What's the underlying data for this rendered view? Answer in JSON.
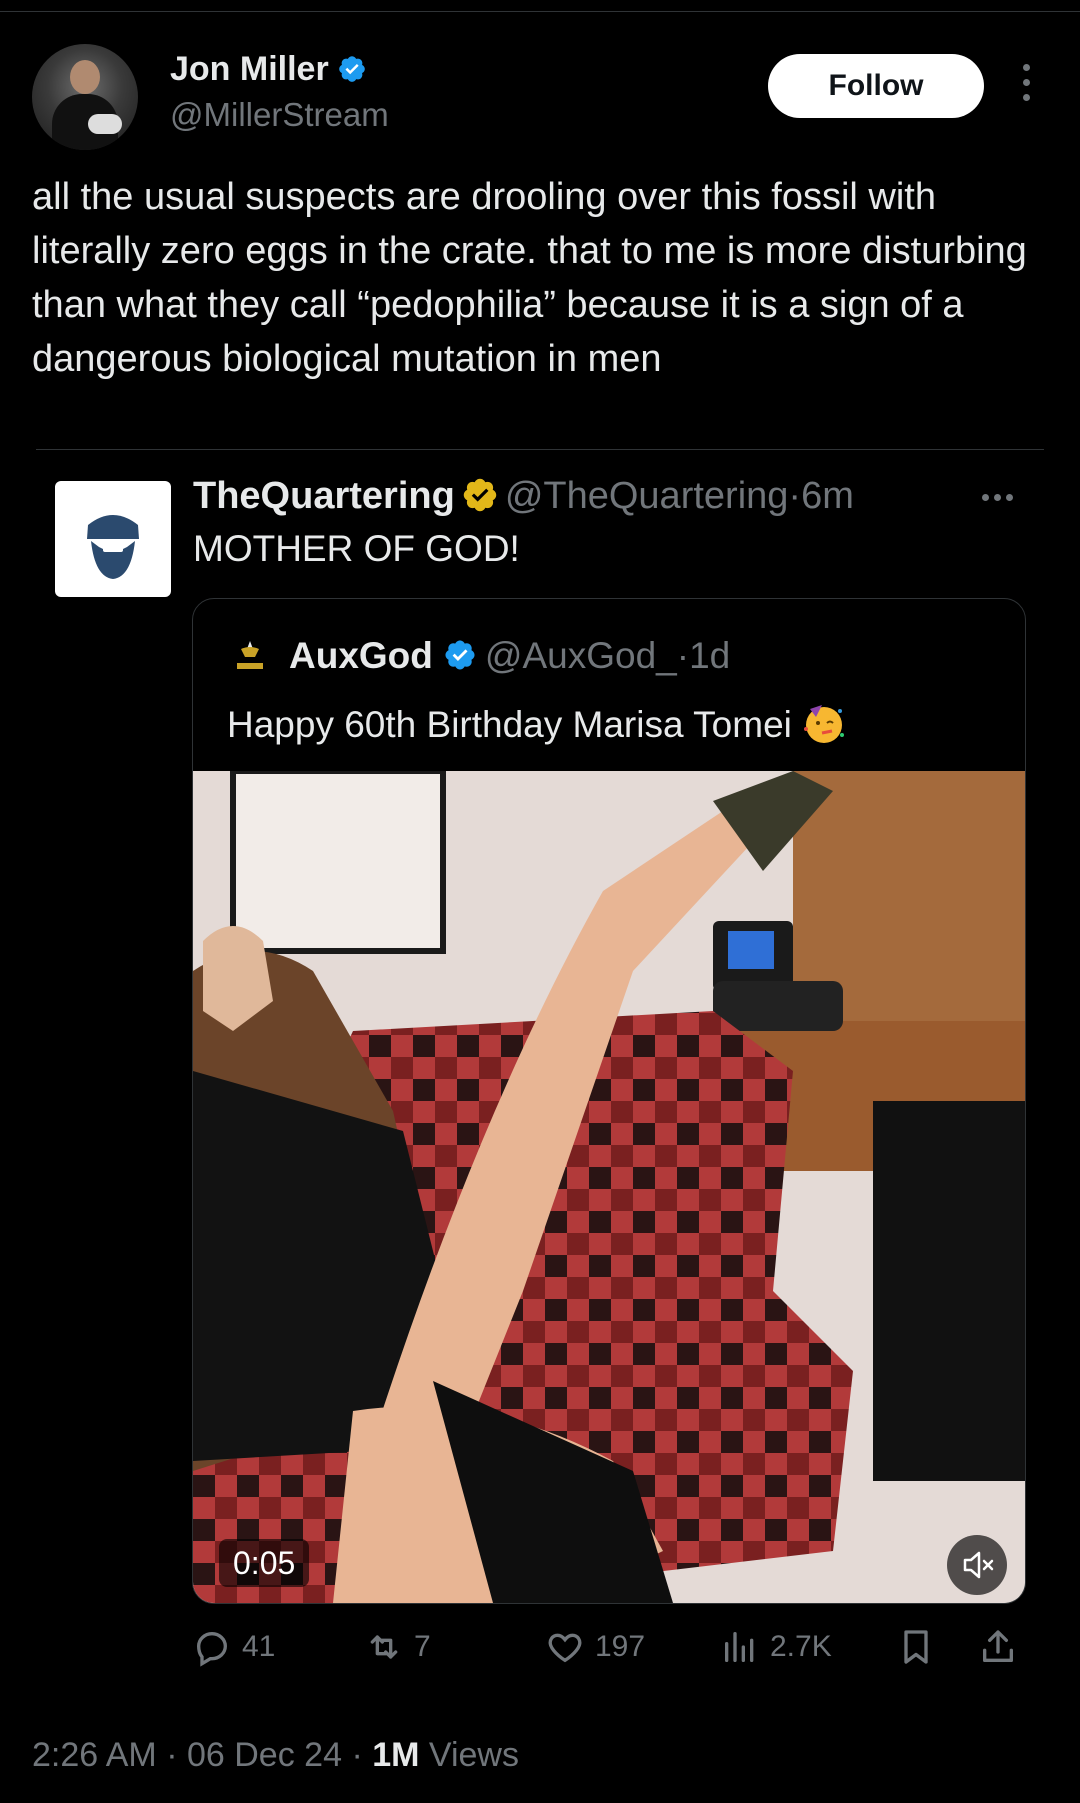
{
  "author": {
    "name": "Jon Miller",
    "handle": "@MillerStream",
    "verified": true
  },
  "header": {
    "follow_label": "Follow"
  },
  "tweet": {
    "text": "all the usual suspects are drooling over this fossil with literally zero eggs in the crate. that to me is more disturbing than what they call “pedophilia” because it is a sign of a dangerous biological mutation in men"
  },
  "quoted": {
    "name": "TheQuartering",
    "handle": "@TheQuartering",
    "time": "6m",
    "text": "MOTHER OF GOD!",
    "nested": {
      "name": "AuxGod",
      "handle": "@AuxGod_",
      "time": "1d",
      "text": "Happy 60th Birthday Marisa Tomei",
      "video_time": "0:05"
    }
  },
  "actions": {
    "replies": "41",
    "reposts": "7",
    "likes": "197",
    "views": "2.7K"
  },
  "meta": {
    "time": "2:26 AM",
    "date": "06 Dec 24",
    "views_count": "1M",
    "views_label": "Views",
    "separator": "·"
  },
  "colors": {
    "background": "#000000",
    "text": "#e7e9ea",
    "muted": "#71767b",
    "verified_blue": "#1d9bf0",
    "verified_gold": "#e2b719"
  }
}
